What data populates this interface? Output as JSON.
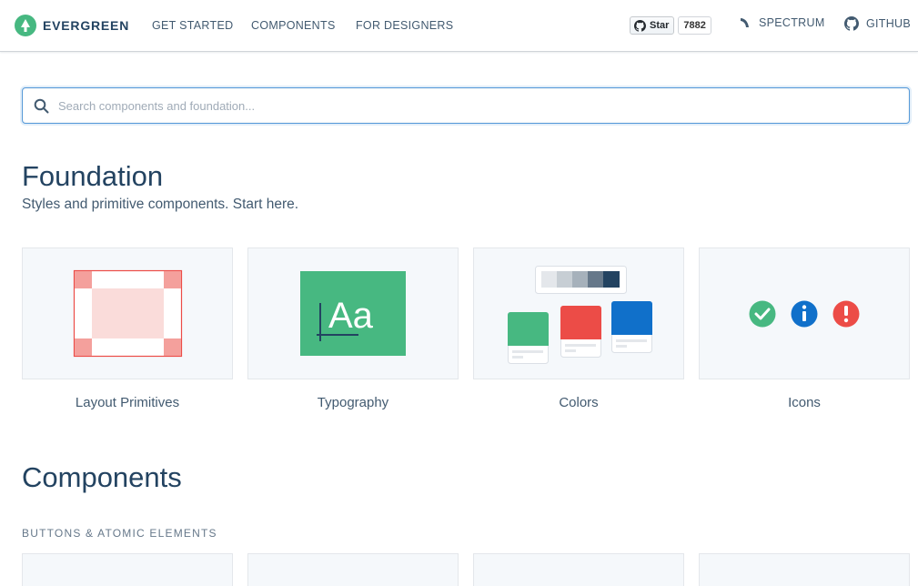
{
  "header": {
    "brand": "EVERGREEN",
    "nav": [
      "GET STARTED",
      "COMPONENTS",
      "FOR DESIGNERS"
    ],
    "github_star": {
      "label": "Star",
      "count": "7882"
    },
    "spectrum_label": "SPECTRUM",
    "github_label": "GITHUB"
  },
  "search": {
    "placeholder": "Search components and foundation...",
    "value": ""
  },
  "foundation": {
    "title": "Foundation",
    "subtitle": "Styles and primitive components. Start here.",
    "cards": [
      {
        "label": "Layout Primitives",
        "icon": "layout-primitives-illustration"
      },
      {
        "label": "Typography",
        "icon": "typography-illustration",
        "glyph": "Aa"
      },
      {
        "label": "Colors",
        "icon": "colors-illustration"
      },
      {
        "label": "Icons",
        "icon": "icons-illustration"
      }
    ]
  },
  "components": {
    "title": "Components",
    "section": "BUTTONS & ATOMIC ELEMENTS"
  },
  "colors": {
    "brand_green": "#47B881",
    "red": "#EC4C47",
    "blue": "#1070CA",
    "navy": "#234361",
    "card_bg": "#F5F8FB"
  }
}
